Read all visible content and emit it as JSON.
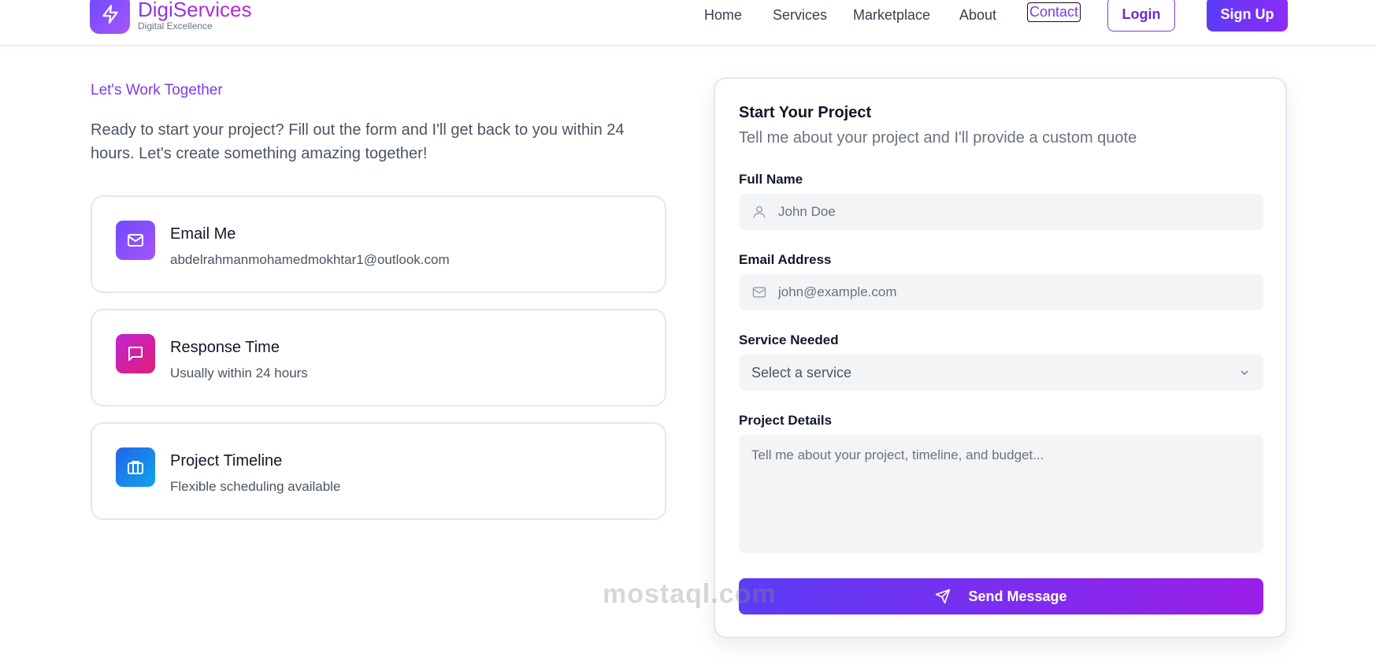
{
  "header": {
    "brand_name": "DigiServices",
    "brand_tagline": "Digital Excellence",
    "nav": [
      "Home",
      "Services",
      "Marketplace",
      "About",
      "Contact"
    ],
    "active_nav": "Contact",
    "login_label": "Login",
    "signup_label": "Sign Up"
  },
  "intro": {
    "eyebrow": "Let's Work Together",
    "text": "Ready to start your project? Fill out the form and I'll get back to you within 24 hours. Let's create something amazing together!"
  },
  "info_cards": [
    {
      "title": "Email Me",
      "subtitle": "abdelrahmanmohamedmokhtar1@outlook.com",
      "icon": "mail-icon",
      "color": "#7c3aed"
    },
    {
      "title": "Response Time",
      "subtitle": "Usually within 24 hours",
      "icon": "message-square-icon",
      "color": "#db2777"
    },
    {
      "title": "Project Timeline",
      "subtitle": "Flexible scheduling available",
      "icon": "briefcase-icon",
      "color": "#2563eb"
    }
  ],
  "form": {
    "title": "Start Your Project",
    "subtitle": "Tell me about your project and I'll provide a custom quote",
    "full_name_label": "Full Name",
    "full_name_placeholder": "John Doe",
    "email_label": "Email Address",
    "email_placeholder": "john@example.com",
    "service_label": "Service Needed",
    "service_selected": "Select a service",
    "details_label": "Project Details",
    "details_placeholder": "Tell me about your project, timeline, and budget...",
    "send_label": "Send Message"
  },
  "watermark": "mostaql.com",
  "colors": {
    "accent": "#7c3aed",
    "field_bg": "#f3f4f6",
    "border": "#e3e6f5"
  }
}
